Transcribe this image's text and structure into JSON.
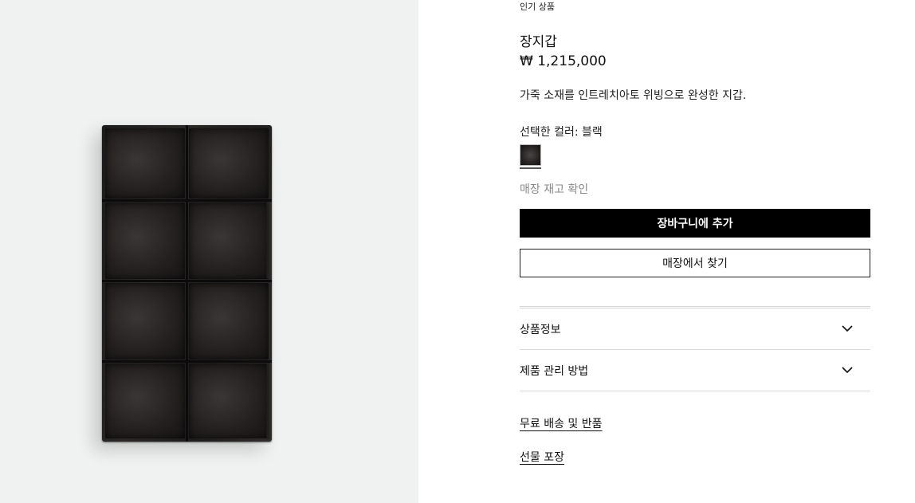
{
  "product": {
    "eyebrow": "인기 상품",
    "title": "장지갑",
    "price": "₩ 1,215,000",
    "description": "가죽 소재를 인트레치아토 위빙으로 완성한 지갑.",
    "selected_color_label": "선택한 컬러:",
    "selected_color_value": "블랙",
    "swatch_color": "#262322",
    "stock_check": "매장 재고 확인"
  },
  "actions": {
    "add_to_cart": "장바구니에 추가",
    "find_in_store": "매장에서 찾기"
  },
  "accordion": {
    "items": [
      {
        "label": "상품정보",
        "icon": "chevron-down-icon"
      },
      {
        "label": "제품 관리 방법",
        "icon": "chevron-down-icon"
      }
    ]
  },
  "links": {
    "shipping": "무료 배송 및 반품",
    "gift": "선물 포장"
  },
  "colors": {
    "image_background": "#eff2f1",
    "primary_button": "#000000",
    "muted_text": "#888888"
  }
}
